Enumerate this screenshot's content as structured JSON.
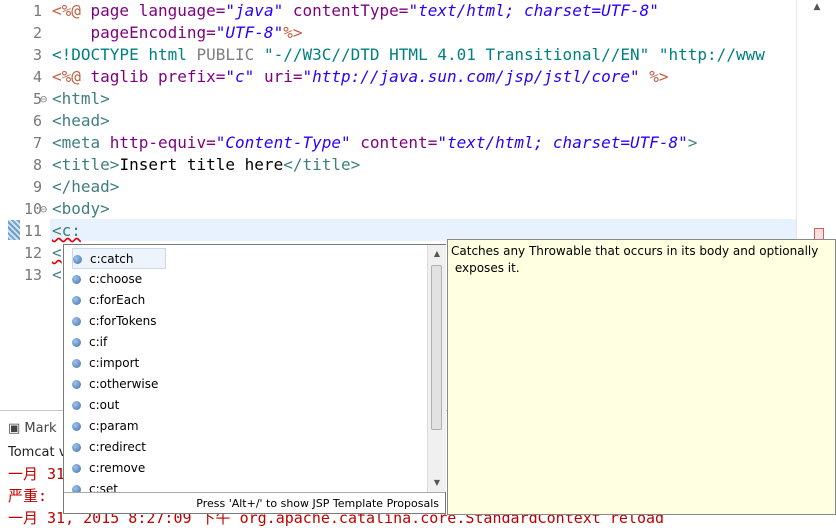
{
  "editor": {
    "line_numbers": [
      "1",
      "2",
      "3",
      "4",
      "5",
      "6",
      "7",
      "8",
      "9",
      "10",
      "11",
      "12",
      "13"
    ],
    "lines": {
      "l1": {
        "open": "<%@ ",
        "kw": "page ",
        "a1": "language=",
        "v1": "\"java\"",
        "a2": " contentType=",
        "v2": "\"text/html; charset=UTF-8\""
      },
      "l2": {
        "a1": "    pageEncoding=",
        "v1": "\"UTF-8\"",
        "close": "%>"
      },
      "l3": {
        "open": "<!DOCTYPE html ",
        "pub": "PUBLIC ",
        "s1": "\"-//W3C//DTD HTML 4.01 Transitional//EN\"",
        "s2": " \"http://www"
      },
      "l4": {
        "open": "<%@ ",
        "kw": "taglib ",
        "a1": "prefix=",
        "v1": "\"c\"",
        "a2": " uri=",
        "v2": "\"http://java.sun.com/jsp/jstl/core\"",
        "close": " %>"
      },
      "l5": {
        "t": "<html>"
      },
      "l6": {
        "t": "<head>"
      },
      "l7": {
        "open": "<meta ",
        "a1": "http-equiv=",
        "v1": "\"Content-Type\"",
        "a2": " content=",
        "v2": "\"text/html; charset=UTF-8\"",
        "close": ">"
      },
      "l8": {
        "open": "<title>",
        "txt": "Insert title here",
        "close": "</title>"
      },
      "l9": {
        "t": "</head>"
      },
      "l10": {
        "t": "<body>"
      },
      "l11": {
        "t": "<c:"
      },
      "l12": {
        "t": "<"
      },
      "l13": {
        "t": "<"
      }
    }
  },
  "console": {
    "tab_label": "Mark",
    "tomcat_label": "Tomcat v",
    "lines": [
      "一月 31",
      "严重:",
      "一月 31, 2015 8:27:09 下午 org.apache.catalina.core.StandardContext reload"
    ]
  },
  "proposals": {
    "items": [
      "c:catch",
      "c:choose",
      "c:forEach",
      "c:forTokens",
      "c:if",
      "c:import",
      "c:otherwise",
      "c:out",
      "c:param",
      "c:redirect",
      "c:remove",
      "c:set"
    ],
    "selected": "c:catch",
    "status_text": "Press 'Alt+/' to show JSP Template Proposals"
  },
  "info_popup": {
    "text": "Catches any Throwable that occurs in its body and optionally\n exposes it."
  }
}
